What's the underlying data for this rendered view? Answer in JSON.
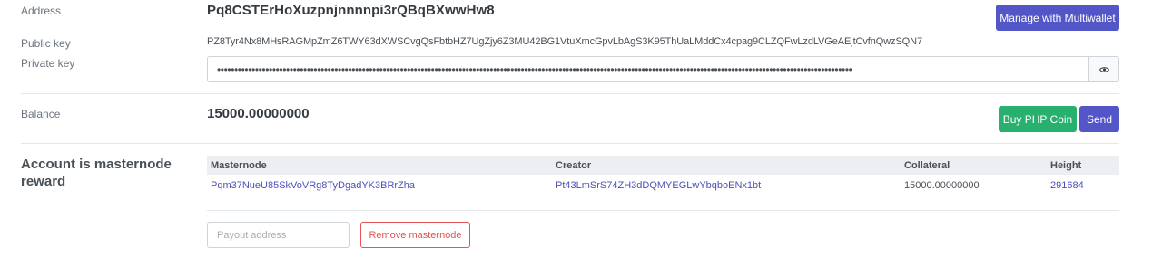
{
  "address": {
    "label": "Address",
    "value": "Pq8CSTErHoXuzpnjnnnnpi3rQBqBXwwHw8",
    "multiwallet_button": "Manage with Multiwallet"
  },
  "public_key": {
    "label": "Public key",
    "value": "PZ8Tyr4Nx8MHsRAGMpZmZ6TWY63dXWSCvgQsFbtbHZ7UgZjy6Z3MU42BG1VtuXmcGpvLbAgS3K95ThUaLMddCx4cpag9CLZQFwLzdLVGeAEjtCvfnQwzSQN7"
  },
  "private_key": {
    "label": "Private key",
    "masked_value": "••••••••••••••••••••••••••••••••••••••••••••••••••••••••••••••••••••••••••••••••••••••••••••••••••••••••••••••••••••••••••••••••••••••••••••••••••••••••••••••••••••••••••••••••••••••••",
    "reveal_icon": "eye-icon"
  },
  "balance": {
    "label": "Balance",
    "value": "15000.00000000",
    "buy_button": "Buy PHP Coin",
    "send_button": "Send"
  },
  "masternode": {
    "title": "Account is masternode reward",
    "columns": [
      "Masternode",
      "Creator",
      "Collateral",
      "Height"
    ],
    "rows": [
      {
        "masternode": "Pqm37NueU85SkVoVRg8TyDgadYK3BRrZha",
        "creator": "Pt43LmSrS74ZH3dDQMYEGLwYbqboENx1bt",
        "collateral": "15000.00000000",
        "height": "291684"
      }
    ],
    "payout_placeholder": "Payout address",
    "remove_button": "Remove masternode"
  },
  "colors": {
    "purple": "#5256c6",
    "green": "#27b06e",
    "danger": "#e55353",
    "link": "#4d50b8"
  }
}
